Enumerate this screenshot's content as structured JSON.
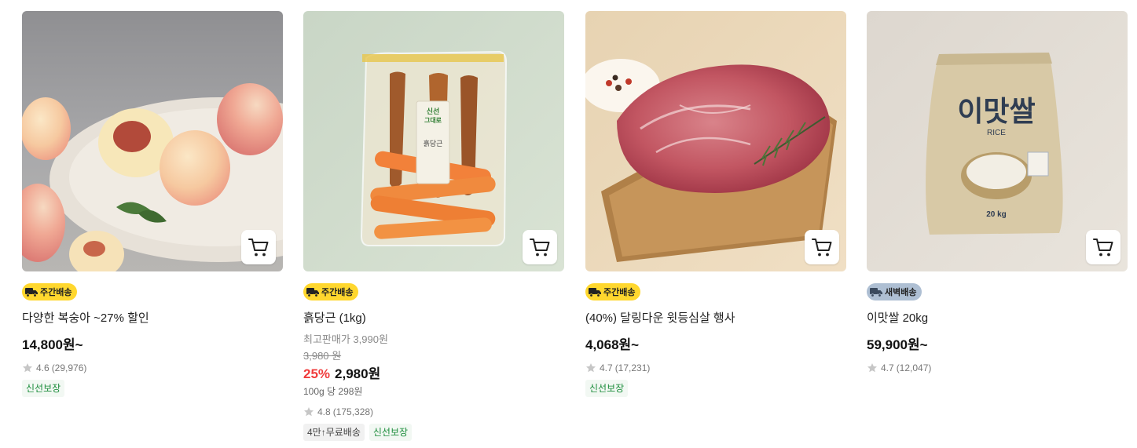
{
  "products": [
    {
      "badge": "주간배송",
      "badge_type": "weekly",
      "title": "다양한 복숭아 ~27% 할인",
      "price": "14,800원~",
      "rating": "4.6",
      "reviews": "(29,976)",
      "tags": [
        "신선보장"
      ],
      "image_icon": "peach-image"
    },
    {
      "badge": "주간배송",
      "badge_type": "weekly",
      "title": "흙당근 (1kg)",
      "orig_label": "최고판매가 3,990원",
      "orig_price": "3,980 원",
      "discount": "25%",
      "sale_price": "2,980원",
      "unit_price": "100g 당 298원",
      "rating": "4.8",
      "reviews": "(175,328)",
      "tags": [
        "4만↑무료배송",
        "신선보장"
      ],
      "package_text": [
        "신선",
        "그대로",
        "흙당근"
      ],
      "image_icon": "carrot-image"
    },
    {
      "badge": "주간배송",
      "badge_type": "weekly",
      "title": "(40%) 달링다운 윗등심살 행사",
      "price": "4,068원~",
      "rating": "4.7",
      "reviews": "(17,231)",
      "tags": [
        "신선보장"
      ],
      "image_icon": "steak-image"
    },
    {
      "badge": "새벽배송",
      "badge_type": "dawn",
      "title": "이맛쌀 20kg",
      "price": "59,900원~",
      "rating": "4.7",
      "reviews": "(12,047)",
      "tags": [],
      "package_text": [
        "이맛쌀",
        "RICE",
        "20 kg"
      ],
      "image_icon": "rice-bag-image"
    }
  ],
  "colors": {
    "weekly_badge": "#ffd72e",
    "dawn_badge": "#aebfd3",
    "discount": "#f03c3c",
    "fresh_tag": "#1a8c3a"
  }
}
